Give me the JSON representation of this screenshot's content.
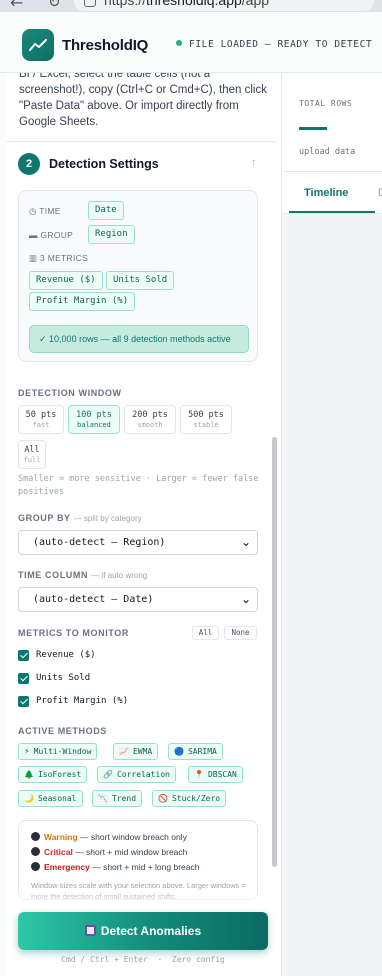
{
  "browser": {
    "url_scheme": "https://",
    "url_host": "thresholdiq.app",
    "url_path": "/app"
  },
  "header": {
    "brand": "ThresholdIQ",
    "status": "FILE LOADED — READY TO DETECT"
  },
  "sidebar": {
    "instructions": "BI / Excel, select the table cells (not a screenshot!), copy (Ctrl+C or Cmd+C), then click \"Paste Data\" above. Or import directly from Google Sheets.",
    "step": {
      "number": "2",
      "title": "Detection Settings",
      "toggle": "↑"
    },
    "detected": {
      "time_label": "TIME",
      "time_value": "Date",
      "group_label": "GROUP",
      "group_value": "Region",
      "metrics_label": "3 METRICS",
      "metrics": [
        "Revenue ($)",
        "Units Sold",
        "Profit Margin (%)"
      ],
      "status": "✓ 10,000 rows — all 9 detection methods active"
    },
    "detection_window": {
      "label": "DETECTION WINDOW",
      "options": [
        {
          "pts": "50 pts",
          "desc": "fast"
        },
        {
          "pts": "100 pts",
          "desc": "balanced"
        },
        {
          "pts": "200 pts",
          "desc": "smooth"
        },
        {
          "pts": "500 pts",
          "desc": "stable"
        },
        {
          "pts": "All",
          "desc": "full"
        }
      ],
      "selected": "100 pts",
      "note": "Smaller = more sensitive · Larger = fewer false positives"
    },
    "group_by": {
      "label": "GROUP BY",
      "hint": "— split by category",
      "value": "(auto-detect — Region)"
    },
    "time_column": {
      "label": "TIME COLUMN",
      "hint": "— if auto wrong",
      "value": "(auto-detect — Date)"
    },
    "metrics_monitor": {
      "label": "METRICS TO MONITOR",
      "all_label": "All",
      "none_label": "None",
      "items": [
        {
          "label": "Revenue ($)",
          "checked": true
        },
        {
          "label": "Units Sold",
          "checked": true
        },
        {
          "label": "Profit Margin (%)",
          "checked": true
        }
      ]
    },
    "active_methods": {
      "label": "ACTIVE METHODS",
      "items": [
        {
          "label": "Multi-Window",
          "icon": "⚡"
        },
        {
          "label": "EWMA",
          "icon": "📈"
        },
        {
          "label": "SARIMA",
          "icon": "🔵"
        },
        {
          "label": "IsoForest",
          "icon": "🌲"
        },
        {
          "label": "Correlation",
          "icon": "🔗"
        },
        {
          "label": "DBSCAN",
          "icon": "📍"
        },
        {
          "label": "Seasonal",
          "icon": "🌙"
        },
        {
          "label": "Trend",
          "icon": "📉"
        },
        {
          "label": "Stuck/Zero",
          "icon": "🚫"
        }
      ]
    },
    "legend": {
      "warning_label": "Warning",
      "warning_desc": " — short window breach only",
      "critical_label": "Critical",
      "critical_desc": " — short + mid window breach",
      "emergency_label": "Emergency",
      "emergency_desc": " — short + mid + long breach",
      "note": "Window sizes scale with your selection above. Larger windows = more ​the detection of small sustained shifts."
    },
    "detect_button": "Detect Anomalies",
    "shortcut": "Cmd / Ctrl + Enter  ·  Zero config"
  },
  "right_panel": {
    "total_rows_label": "TOTAL ROWS",
    "total_rows_sub": "upload data",
    "tabs": [
      "Timeline",
      "D"
    ]
  },
  "colors": {
    "accent": "#0f766e",
    "accent_light": "#ecfdf5",
    "warning": "#d97706",
    "critical": "#dc2626",
    "emergency": "#b91c1c"
  }
}
